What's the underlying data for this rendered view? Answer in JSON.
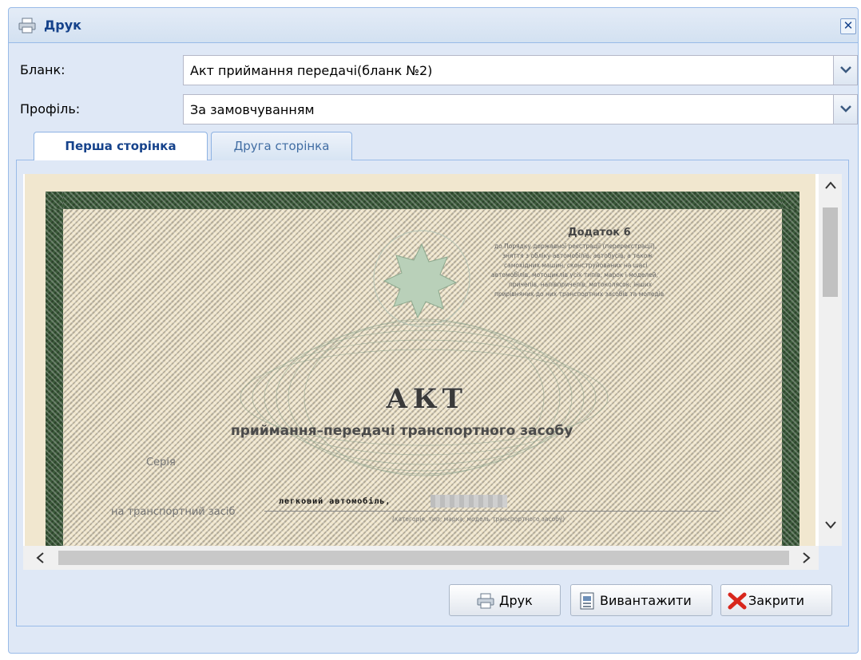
{
  "window": {
    "title": "Друк",
    "close_glyph": "✕"
  },
  "form": {
    "blank_label": "Бланк:",
    "blank_value": "Акт приймання передачі(бланк №2)",
    "profile_label": "Профіль:",
    "profile_value": "За замовчуванням"
  },
  "tabs": [
    {
      "label": "Перша сторінка",
      "active": true
    },
    {
      "label": "Друга сторінка",
      "active": false
    }
  ],
  "document": {
    "addendum_title": "Додаток 6",
    "addendum_lines": [
      "до Порядку державної реєстрації (перереєстрації),",
      "зняття з обліку автомобілів, автобусів, а також",
      "самохідних машин, сконструйованих на шасі",
      "автомобілів, мотоциклів усіх типів, марок і моделей,",
      "причепів, напівпричепів, мотоколясок, інших",
      "прирівняних до них транспортних засобів та мопедів"
    ],
    "act_title": "АКТ",
    "act_subtitle": "приймання–передачі транспортного засобу",
    "serie_label": "Серія",
    "vehicle_label": "на транспортний засіб",
    "vehicle_type": "легковий автомобіль,",
    "vehicle_hint": "(категорія, тип, марка, модель транспортного засобу)"
  },
  "scrollbars": {
    "up": "⌃",
    "down": "⌄",
    "left": "<",
    "right": ">"
  },
  "buttons": {
    "print": "Друк",
    "export": "Вивантажити",
    "close": "Закрити"
  },
  "colors": {
    "window_bg": "#dfe8f6",
    "title_text": "#15428b",
    "border": "#99bbe8",
    "certificate_frame": "#3b5a3a",
    "paper": "#efe5cb",
    "close_icon_red": "#d8261c"
  },
  "icons": {
    "title": "printer-icon",
    "print_button": "printer-icon",
    "export_button": "export-document-icon",
    "close_button": "red-x-icon",
    "combo_trigger": "chevron-down-icon"
  }
}
